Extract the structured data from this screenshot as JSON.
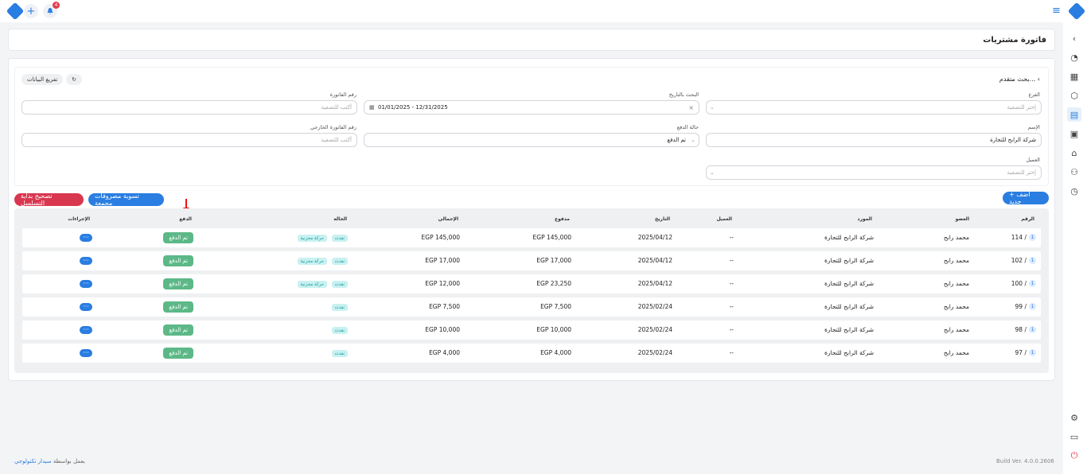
{
  "topbar": {
    "notification_count": "4"
  },
  "page_title": "فاتورة مشتريات",
  "filters": {
    "advanced_search": "بحث متقدم...",
    "clear_data": "تفريغ البيانات",
    "branch_label": "الفرع",
    "branch_placeholder": "إختر للتصفية",
    "date_search_label": "البحث بالتاريخ",
    "date_range": "01/01/2025 - 12/31/2025",
    "invoice_number_label": "رقم الفاتورة",
    "invoice_number_placeholder": "أكتب للتصفية",
    "name_label": "الإسم",
    "name_value": "شركة الرابح للتجارة",
    "payment_status_label": "حالة الدفع",
    "payment_status_value": "تم الدفع",
    "external_invoice_label": "رقم الفاتورة الخارجي",
    "external_invoice_placeholder": "أكتب للتصفية",
    "client_label": "العميل",
    "client_placeholder": "إختر للتصفية"
  },
  "actions": {
    "add_new": "+ أضف جديد",
    "aggregate_expenses": "تسوية مصروفات مجمعة",
    "fix_sequence": "تصحيح بداية التسلسل"
  },
  "table": {
    "headers": {
      "number": "الرقم",
      "member": "العضو",
      "supplier": "المورد",
      "client": "العميل",
      "date": "التاريخ",
      "paid": "مدفوع",
      "total": "الإجمالي",
      "status": "الحالة",
      "payment": "الدفع",
      "actions": "الإجراءات"
    },
    "rows": [
      {
        "badge": "1",
        "number": "114 /",
        "member": "محمد رابح",
        "supplier": "شركة الرابح للتجارة",
        "client": "--",
        "date": "2025/04/12",
        "paid": "EGP 145,000",
        "total": "EGP 145,000",
        "tag1": "نقدت",
        "tag2": "حركة مخزنية",
        "payment": "تم الدفع",
        "actions": "···"
      },
      {
        "badge": "1",
        "number": "102 /",
        "member": "محمد رابح",
        "supplier": "شركة الرابح للتجارة",
        "client": "--",
        "date": "2025/04/12",
        "paid": "EGP 17,000",
        "total": "EGP 17,000",
        "tag1": "نقدت",
        "tag2": "حركة مخزنية",
        "payment": "تم الدفع",
        "actions": "···"
      },
      {
        "badge": "1",
        "number": "100 /",
        "member": "محمد رابح",
        "supplier": "شركة الرابح للتجارة",
        "client": "--",
        "date": "2025/04/12",
        "paid": "EGP 23,250",
        "total": "EGP 12,000",
        "tag1": "نقدت",
        "tag2": "حركة مخزنية",
        "payment": "تم الدفع",
        "actions": "···"
      },
      {
        "badge": "1",
        "number": "99 /",
        "member": "محمد رابح",
        "supplier": "شركة الرابح للتجارة",
        "client": "--",
        "date": "2025/02/24",
        "paid": "EGP 7,500",
        "total": "EGP 7,500",
        "tag1": "نقدت",
        "tag2": "",
        "payment": "تم الدفع",
        "actions": "···"
      },
      {
        "badge": "1",
        "number": "98 /",
        "member": "محمد رابح",
        "supplier": "شركة الرابح للتجارة",
        "client": "--",
        "date": "2025/02/24",
        "paid": "EGP 10,000",
        "total": "EGP 10,000",
        "tag1": "نقدت",
        "tag2": "",
        "payment": "تم الدفع",
        "actions": "···"
      },
      {
        "badge": "1",
        "number": "97 /",
        "member": "محمد رابح",
        "supplier": "شركة الرابح للتجارة",
        "client": "--",
        "date": "2025/02/24",
        "paid": "EGP 4,000",
        "total": "EGP 4,000",
        "tag1": "نقدت",
        "tag2": "",
        "payment": "تم الدفع",
        "actions": "···"
      }
    ]
  },
  "footer": {
    "powered_by": "يعمل بواسطة",
    "company": "سيدار تكنولوجي",
    "build": "Build Ver. 4.0.0.2606"
  },
  "colors": {
    "accent": "#2a7de1",
    "paid": "#5cb887",
    "danger": "#d9364f"
  }
}
